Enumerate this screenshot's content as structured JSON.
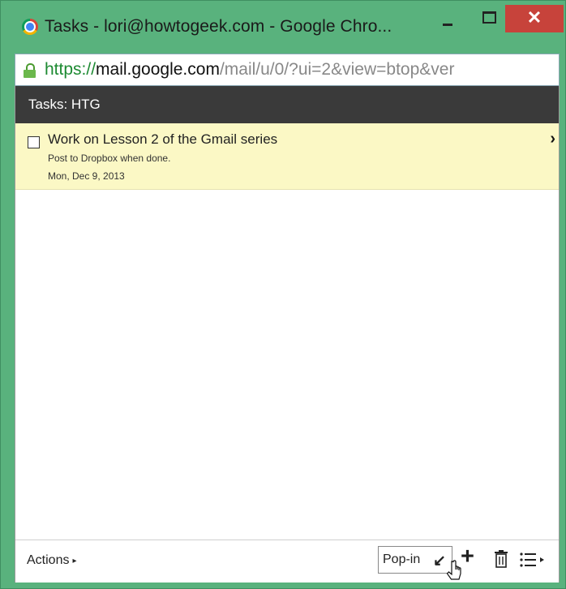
{
  "window": {
    "title": "Tasks - lori@howtogeek.com - Google Chro...",
    "close_label": "✕"
  },
  "address": {
    "scheme": "https://",
    "host": "mail.google.com",
    "path": "/mail/u/0/?ui=2&view=btop&ver"
  },
  "tasks": {
    "header": "Tasks: HTG",
    "items": [
      {
        "title": "Work on Lesson 2 of the Gmail series",
        "notes": "Post to Dropbox when done.",
        "date": "Mon, Dec 9, 2013",
        "completed": false
      }
    ]
  },
  "footer": {
    "actions_label": "Actions",
    "actions_arrow": "▸",
    "popin_label": "Pop-in",
    "popin_arrow": "↙",
    "add_label": "+"
  },
  "icons": {
    "chevron": "›"
  },
  "colors": {
    "window_frame": "#59b27d",
    "close_button": "#c7433b",
    "header_bg": "#3a3a3a",
    "task_highlight": "#fbf8c5",
    "url_scheme": "#1d8a32"
  }
}
